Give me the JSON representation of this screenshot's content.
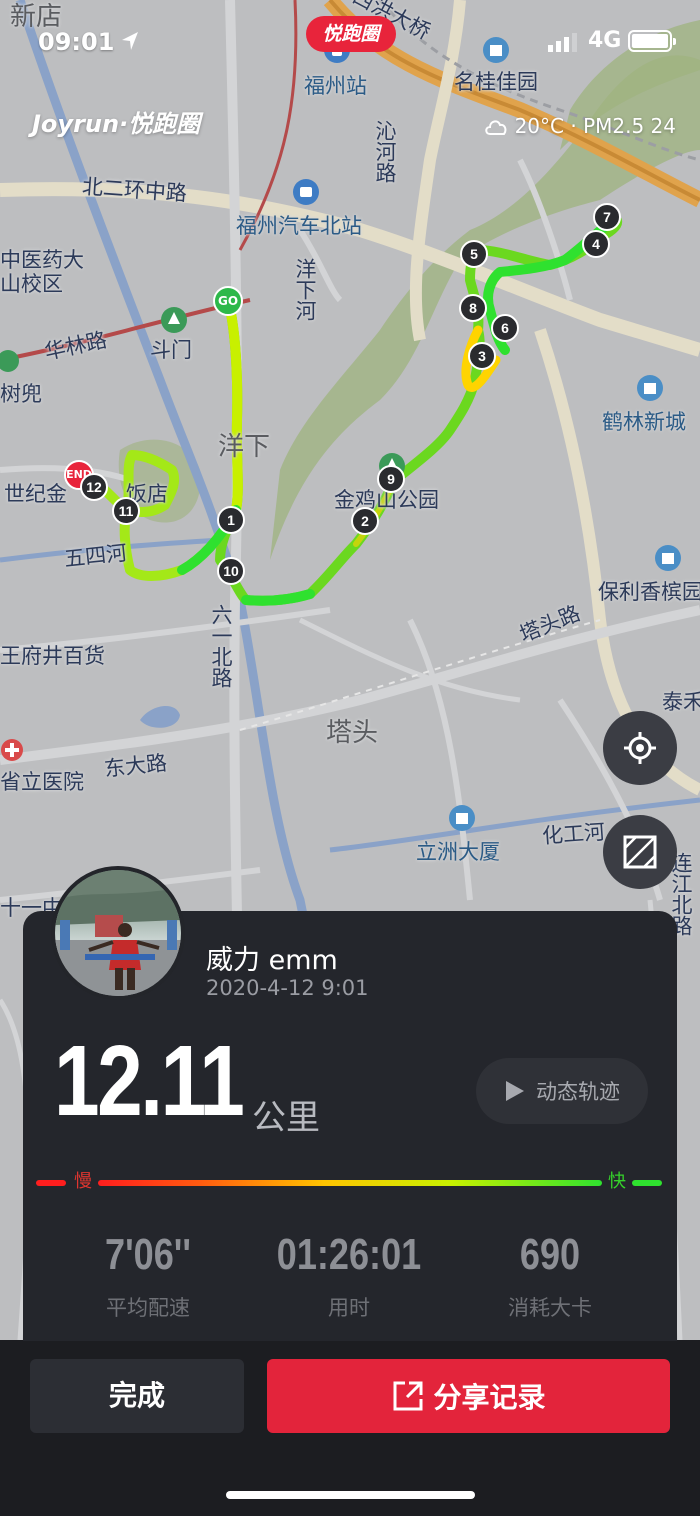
{
  "status_bar": {
    "time": "09:01",
    "brand_pill": "悦跑圈",
    "network": "4G"
  },
  "header": {
    "logo": "Joyrun·悦跑圈",
    "weather": "20°C · PM2.5 24"
  },
  "map": {
    "labels": [
      {
        "text": "新店",
        "kind": "big"
      },
      {
        "text": "西洪大桥",
        "kind": "road"
      },
      {
        "text": "福州站",
        "kind": "poi"
      },
      {
        "text": "名桂佳园",
        "kind": "road"
      },
      {
        "text": "北二环中路",
        "kind": "road"
      },
      {
        "text": "沁河路",
        "kind": "road"
      },
      {
        "text": "福州汽车北站",
        "kind": "poi"
      },
      {
        "text": "中医药大",
        "kind": "road"
      },
      {
        "text": "山校区",
        "kind": "road"
      },
      {
        "text": "洋下河",
        "kind": "road"
      },
      {
        "text": "华林路",
        "kind": "road"
      },
      {
        "text": "斗门",
        "kind": "road"
      },
      {
        "text": "树兜",
        "kind": "road"
      },
      {
        "text": "鹤林新城",
        "kind": "poi"
      },
      {
        "text": "洋下",
        "kind": "big"
      },
      {
        "text": "世纪金",
        "kind": "road"
      },
      {
        "text": "饭店",
        "kind": "road"
      },
      {
        "text": "金鸡山公园",
        "kind": "road"
      },
      {
        "text": "五四河",
        "kind": "road"
      },
      {
        "text": "保利香槟园",
        "kind": "road"
      },
      {
        "text": "塔头路",
        "kind": "road"
      },
      {
        "text": "六一北路",
        "kind": "road"
      },
      {
        "text": "王府井百货",
        "kind": "road"
      },
      {
        "text": "泰禾",
        "kind": "road"
      },
      {
        "text": "塔头",
        "kind": "big"
      },
      {
        "text": "东大路",
        "kind": "road"
      },
      {
        "text": "省立医院",
        "kind": "road"
      },
      {
        "text": "化工河",
        "kind": "road"
      },
      {
        "text": "立洲大厦",
        "kind": "poi"
      },
      {
        "text": "连江北路",
        "kind": "road"
      },
      {
        "text": "十一中",
        "kind": "road"
      }
    ],
    "markers": [
      "GO",
      "END",
      "1",
      "2",
      "3",
      "4",
      "5",
      "6",
      "7",
      "8",
      "9",
      "10",
      "11",
      "12"
    ],
    "colors": {
      "route_fast": "#2fe12f",
      "route_mid": "#c8f000",
      "route_slow": "#ffd400",
      "marker": "#2a2b2f",
      "go": "#2db84a",
      "end": "#e8243b"
    }
  },
  "controls": {
    "locate_icon": "crosshair-icon",
    "layer_icon": "map-layer-icon"
  },
  "summary": {
    "username": "威力 emm",
    "date": "2020-4-12 9:01",
    "distance": "12.11",
    "distance_unit": "公里",
    "replay_label": "动态轨迹",
    "pace_slow": "慢",
    "pace_fast": "快",
    "stats": [
      {
        "value": "7'06''",
        "label": "平均配速"
      },
      {
        "value": "01:26:01",
        "label": "用时"
      },
      {
        "value": "690",
        "label": "消耗大卡"
      }
    ]
  },
  "actions": {
    "done_label": "完成",
    "share_label": "分享记录"
  }
}
